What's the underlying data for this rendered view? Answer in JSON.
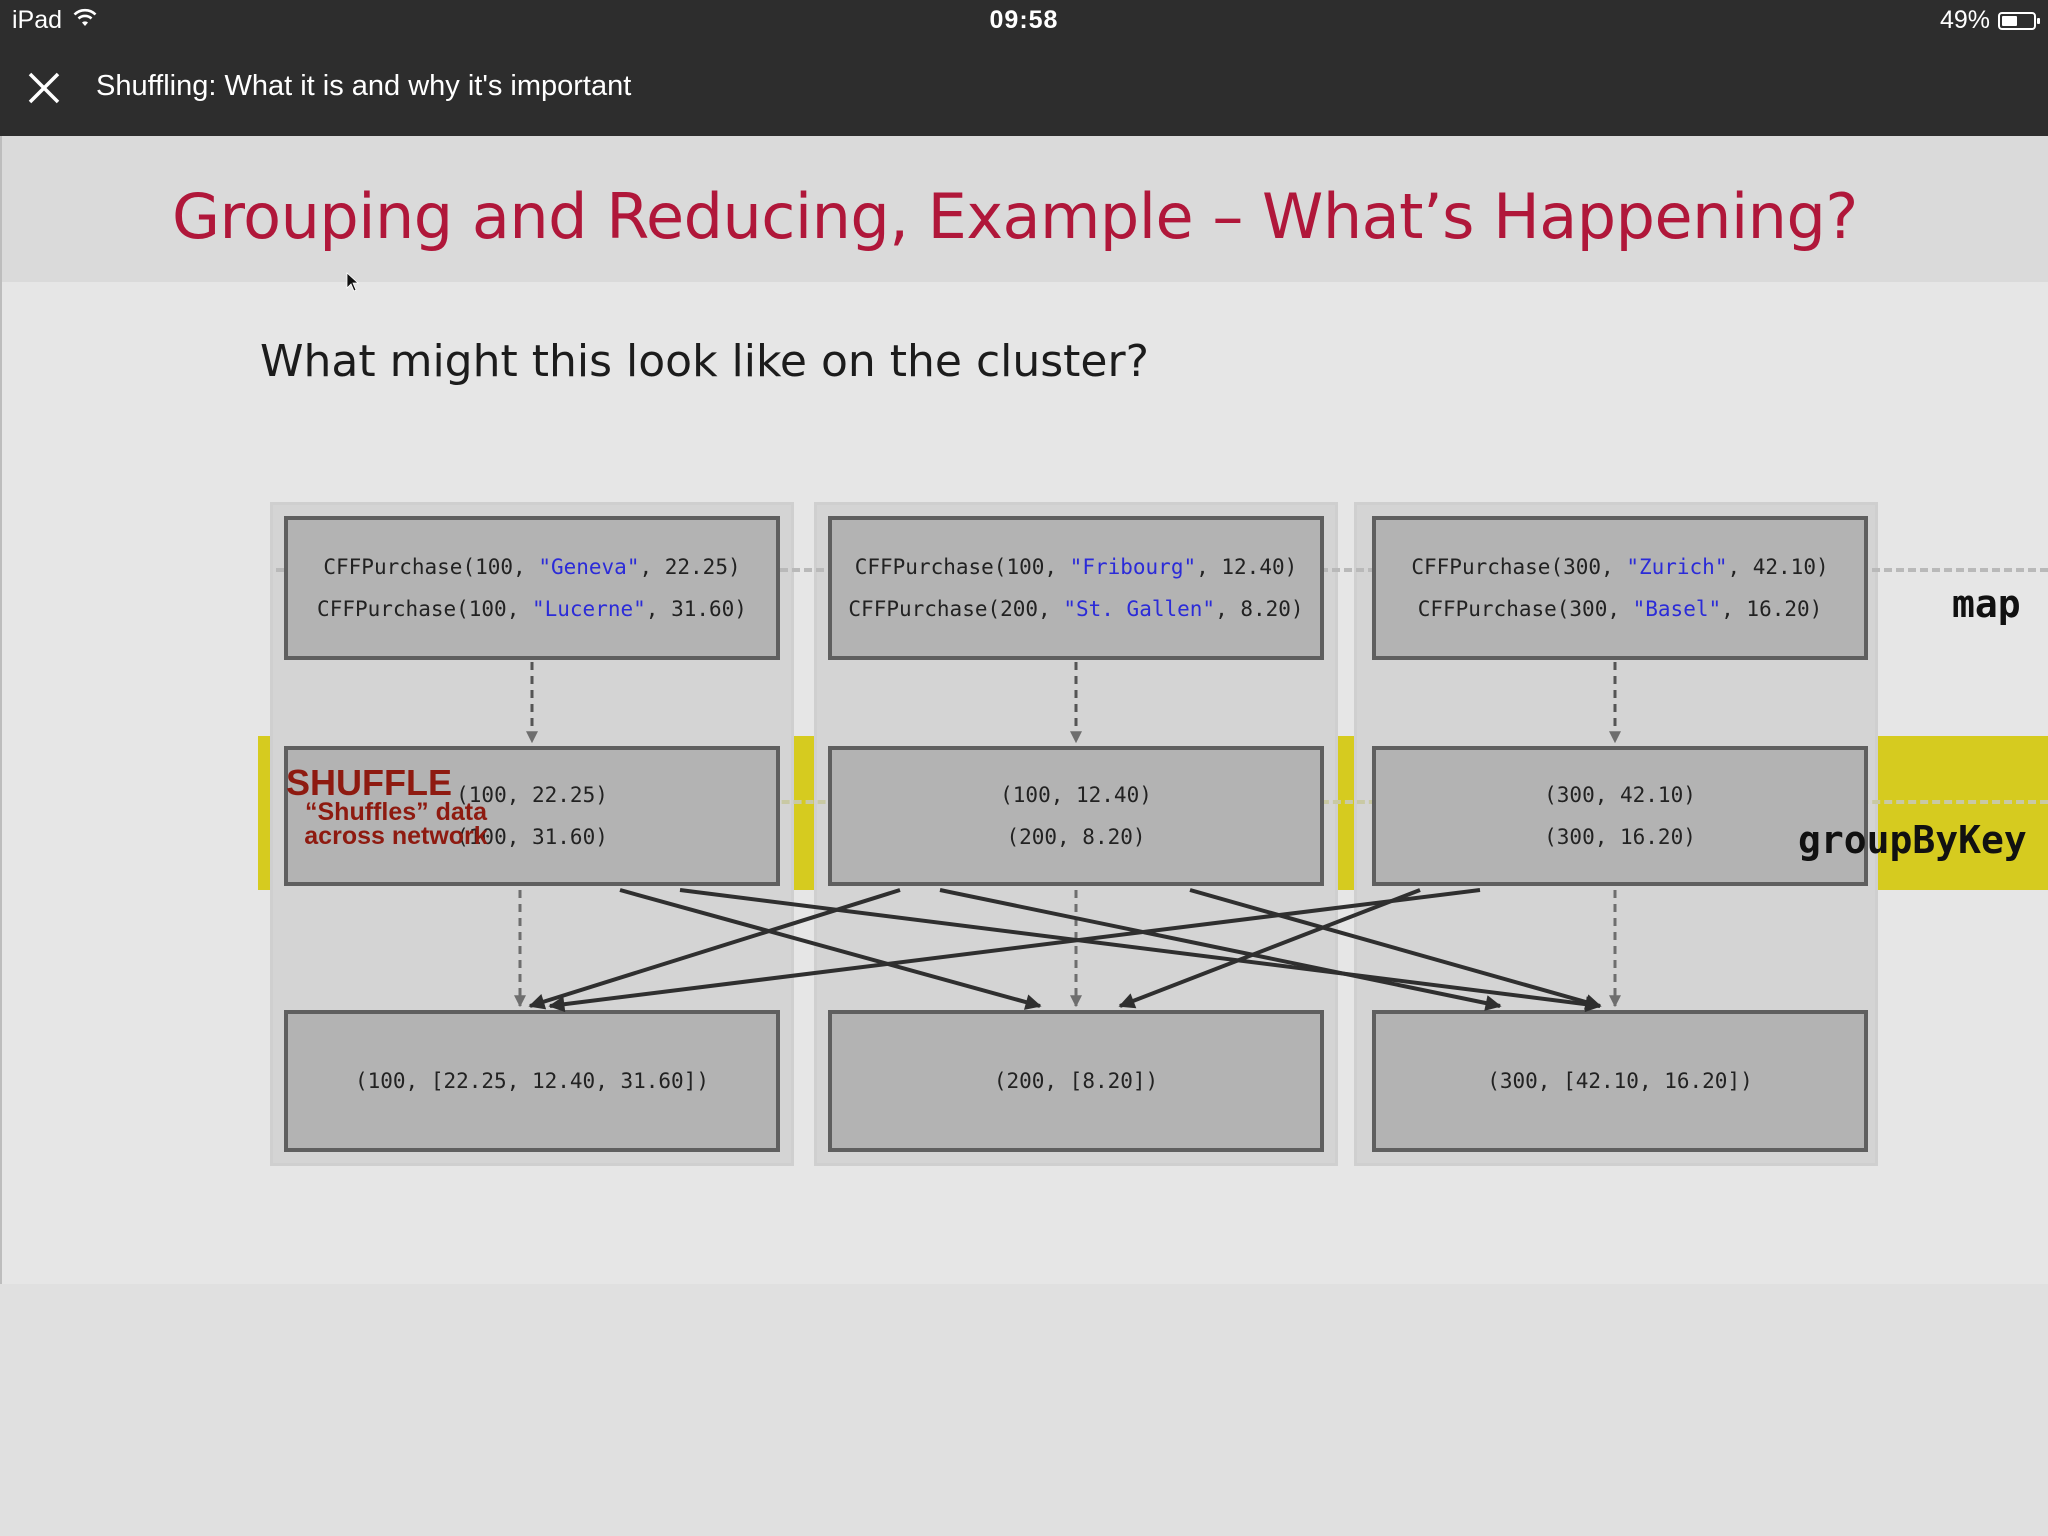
{
  "status_bar": {
    "device": "iPad",
    "time": "09:58",
    "battery": "49%",
    "battery_level": 0.49,
    "icons": [
      "wifi-icon",
      "battery-icon"
    ]
  },
  "player": {
    "title": "Shuffling: What it is and why it's important",
    "close_icon": "close-icon"
  },
  "slide": {
    "title": "Grouping and Reducing, Example – What’s Happening?",
    "subtitle": "What might this look like on the cluster?",
    "shuffle_title": "SHUFFLE",
    "shuffle_desc_line1": "“Shuffles” data",
    "shuffle_desc_line2": "across network",
    "op_map": "map",
    "op_group": "groupByKey",
    "colors": {
      "title": "#b0173a",
      "shuffle_band": "#d6cb1f",
      "shuffle_text": "#8e1a10",
      "city": "#2b2bd8"
    },
    "nodes": [
      {
        "purchases": [
          {
            "prefix": "CFFPurchase(100, ",
            "city": "\"Geneva\"",
            "suffix": ", 22.25)"
          },
          {
            "prefix": "CFFPurchase(100, ",
            "city": "\"Lucerne\"",
            "suffix": ", 31.60)"
          }
        ],
        "pairs": [
          "(100, 22.25)",
          "(100, 31.60)"
        ],
        "grouped": "(100, [22.25, 12.40, 31.60])"
      },
      {
        "purchases": [
          {
            "prefix": "CFFPurchase(100, ",
            "city": "\"Fribourg\"",
            "suffix": ", 12.40)"
          },
          {
            "prefix": "CFFPurchase(200, ",
            "city": "\"St. Gallen\"",
            "suffix": ", 8.20)"
          }
        ],
        "pairs": [
          "(100, 12.40)",
          "(200, 8.20)"
        ],
        "grouped": "(200, [8.20])"
      },
      {
        "purchases": [
          {
            "prefix": "CFFPurchase(300, ",
            "city": "\"Zurich\"",
            "suffix": ", 42.10)"
          },
          {
            "prefix": "CFFPurchase(300, ",
            "city": "\"Basel\"",
            "suffix": ", 16.20)"
          }
        ],
        "pairs": [
          "(300, 42.10)",
          "(300, 16.20)"
        ],
        "grouped": "(300, [42.10, 16.20])"
      }
    ]
  }
}
